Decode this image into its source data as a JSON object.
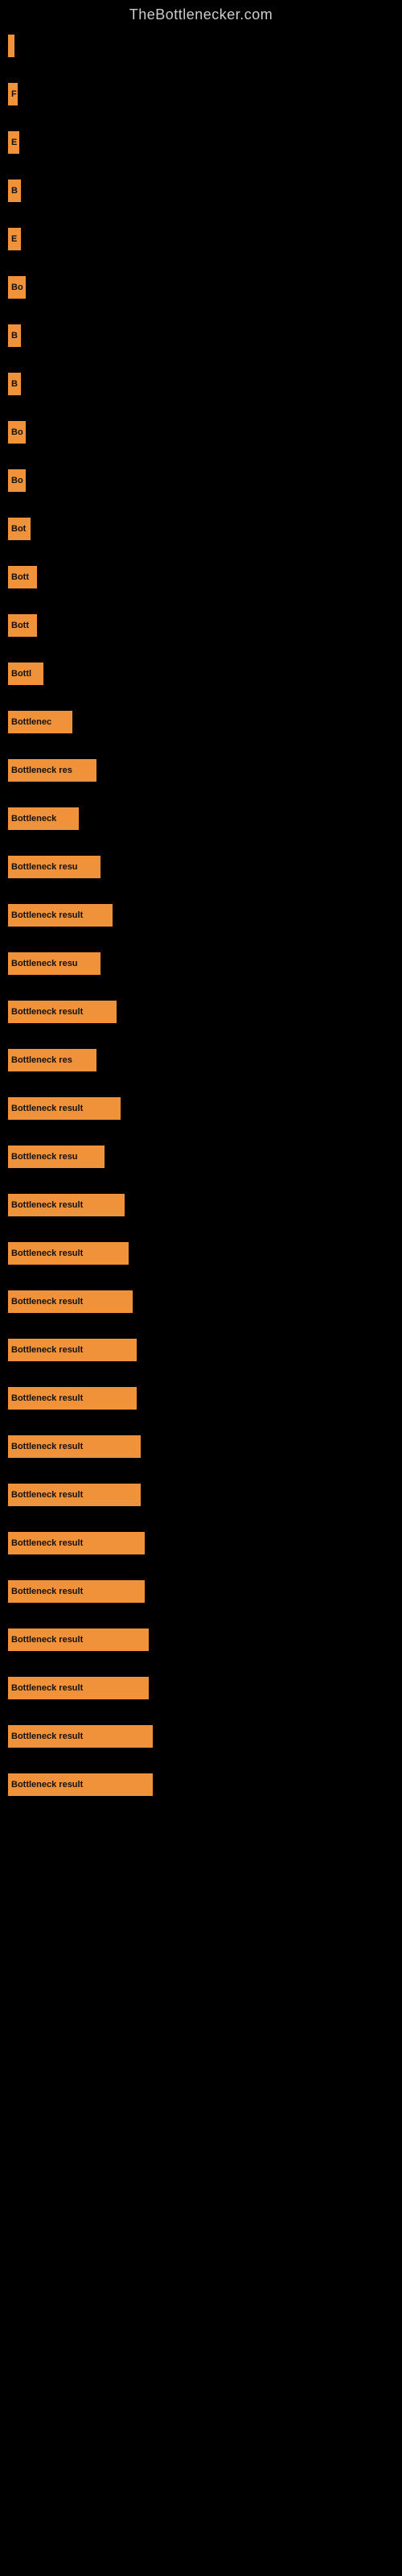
{
  "site": {
    "title": "TheBottlenecker.com"
  },
  "bars": [
    {
      "label": "",
      "width": 8,
      "gap": 30
    },
    {
      "label": "F",
      "width": 12,
      "gap": 30
    },
    {
      "label": "E",
      "width": 14,
      "gap": 30
    },
    {
      "label": "B",
      "width": 16,
      "gap": 30
    },
    {
      "label": "E",
      "width": 16,
      "gap": 30
    },
    {
      "label": "Bo",
      "width": 22,
      "gap": 30
    },
    {
      "label": "B",
      "width": 16,
      "gap": 30
    },
    {
      "label": "B",
      "width": 16,
      "gap": 30
    },
    {
      "label": "Bo",
      "width": 22,
      "gap": 30
    },
    {
      "label": "Bo",
      "width": 22,
      "gap": 30
    },
    {
      "label": "Bot",
      "width": 28,
      "gap": 30
    },
    {
      "label": "Bott",
      "width": 36,
      "gap": 30
    },
    {
      "label": "Bott",
      "width": 36,
      "gap": 30
    },
    {
      "label": "Bottl",
      "width": 44,
      "gap": 30
    },
    {
      "label": "Bottlenec",
      "width": 80,
      "gap": 30
    },
    {
      "label": "Bottleneck res",
      "width": 110,
      "gap": 30
    },
    {
      "label": "Bottleneck",
      "width": 88,
      "gap": 30
    },
    {
      "label": "Bottleneck resu",
      "width": 115,
      "gap": 30
    },
    {
      "label": "Bottleneck result",
      "width": 130,
      "gap": 30
    },
    {
      "label": "Bottleneck resu",
      "width": 115,
      "gap": 30
    },
    {
      "label": "Bottleneck result",
      "width": 135,
      "gap": 30
    },
    {
      "label": "Bottleneck res",
      "width": 110,
      "gap": 30
    },
    {
      "label": "Bottleneck result",
      "width": 140,
      "gap": 30
    },
    {
      "label": "Bottleneck resu",
      "width": 120,
      "gap": 30
    },
    {
      "label": "Bottleneck result",
      "width": 145,
      "gap": 30
    },
    {
      "label": "Bottleneck result",
      "width": 150,
      "gap": 30
    },
    {
      "label": "Bottleneck result",
      "width": 155,
      "gap": 30
    },
    {
      "label": "Bottleneck result",
      "width": 160,
      "gap": 30
    },
    {
      "label": "Bottleneck result",
      "width": 160,
      "gap": 30
    },
    {
      "label": "Bottleneck result",
      "width": 165,
      "gap": 30
    },
    {
      "label": "Bottleneck result",
      "width": 165,
      "gap": 30
    },
    {
      "label": "Bottleneck result",
      "width": 170,
      "gap": 30
    },
    {
      "label": "Bottleneck result",
      "width": 170,
      "gap": 30
    },
    {
      "label": "Bottleneck result",
      "width": 175,
      "gap": 30
    },
    {
      "label": "Bottleneck result",
      "width": 175,
      "gap": 30
    },
    {
      "label": "Bottleneck result",
      "width": 180,
      "gap": 30
    },
    {
      "label": "Bottleneck result",
      "width": 180,
      "gap": 0
    }
  ]
}
